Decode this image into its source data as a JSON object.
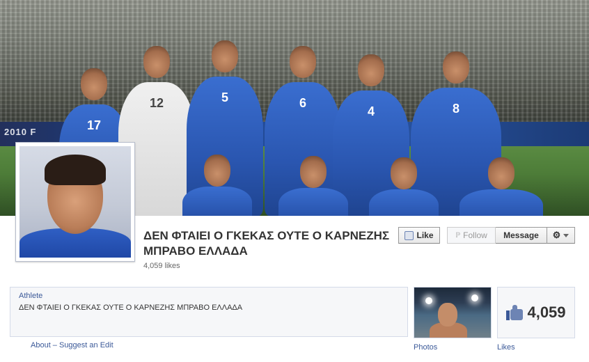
{
  "cover": {
    "banner_text": "2010 F",
    "players": [
      {
        "number": "17"
      },
      {
        "number": "12"
      },
      {
        "number": "5"
      },
      {
        "number": "6"
      },
      {
        "number": "4"
      },
      {
        "number": "8"
      }
    ]
  },
  "page": {
    "title": "ΔΕΝ ΦΤΑΙΕΙ Ο ΓΚΕΚΑΣ ΟΥΤΕ Ο ΚΑΡΝΕΖΗΣ ΜΠΡΑΒΟ ΕΛΛΑΔΑ",
    "likes_text": "4,059 likes"
  },
  "actions": {
    "like_label": "Like",
    "follow_label": "Follow",
    "message_label": "Message"
  },
  "info": {
    "category": "Athlete",
    "description": "ΔΕΝ ΦΤΑΙΕΙ Ο ΓΚΕΚΑΣ ΟΥΤΕ Ο ΚΑΡΝΕΖΗΣ ΜΠΡΑΒΟ ΕΛΛΑΔΑ",
    "about_link": "About – Suggest an Edit"
  },
  "tiles": {
    "photos_label": "Photos",
    "likes_number": "4,059",
    "likes_label": "Likes"
  },
  "colors": {
    "link": "#3b5998",
    "jersey_blue": "#2a56b0"
  },
  "icons": [
    "like-thumb-icon",
    "rss-icon",
    "gear-icon",
    "chevron-down-icon"
  ]
}
